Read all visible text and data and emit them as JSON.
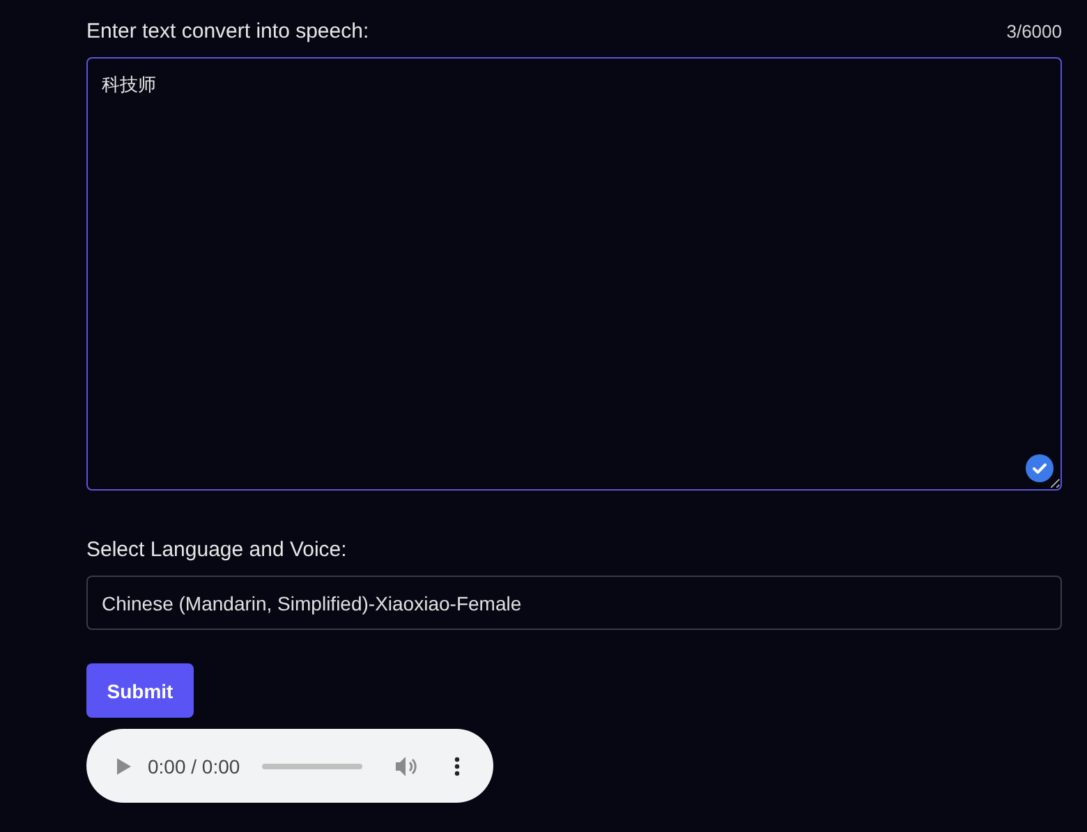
{
  "text_input": {
    "label": "Enter text convert into speech:",
    "counter": "3/6000",
    "value": "科技师",
    "valid": true
  },
  "voice": {
    "label": "Select Language and Voice:",
    "value": "Chinese (Mandarin, Simplified)-Xiaoxiao-Female"
  },
  "submit": {
    "label": "Submit"
  },
  "audio": {
    "time": "0:00 / 0:00"
  }
}
